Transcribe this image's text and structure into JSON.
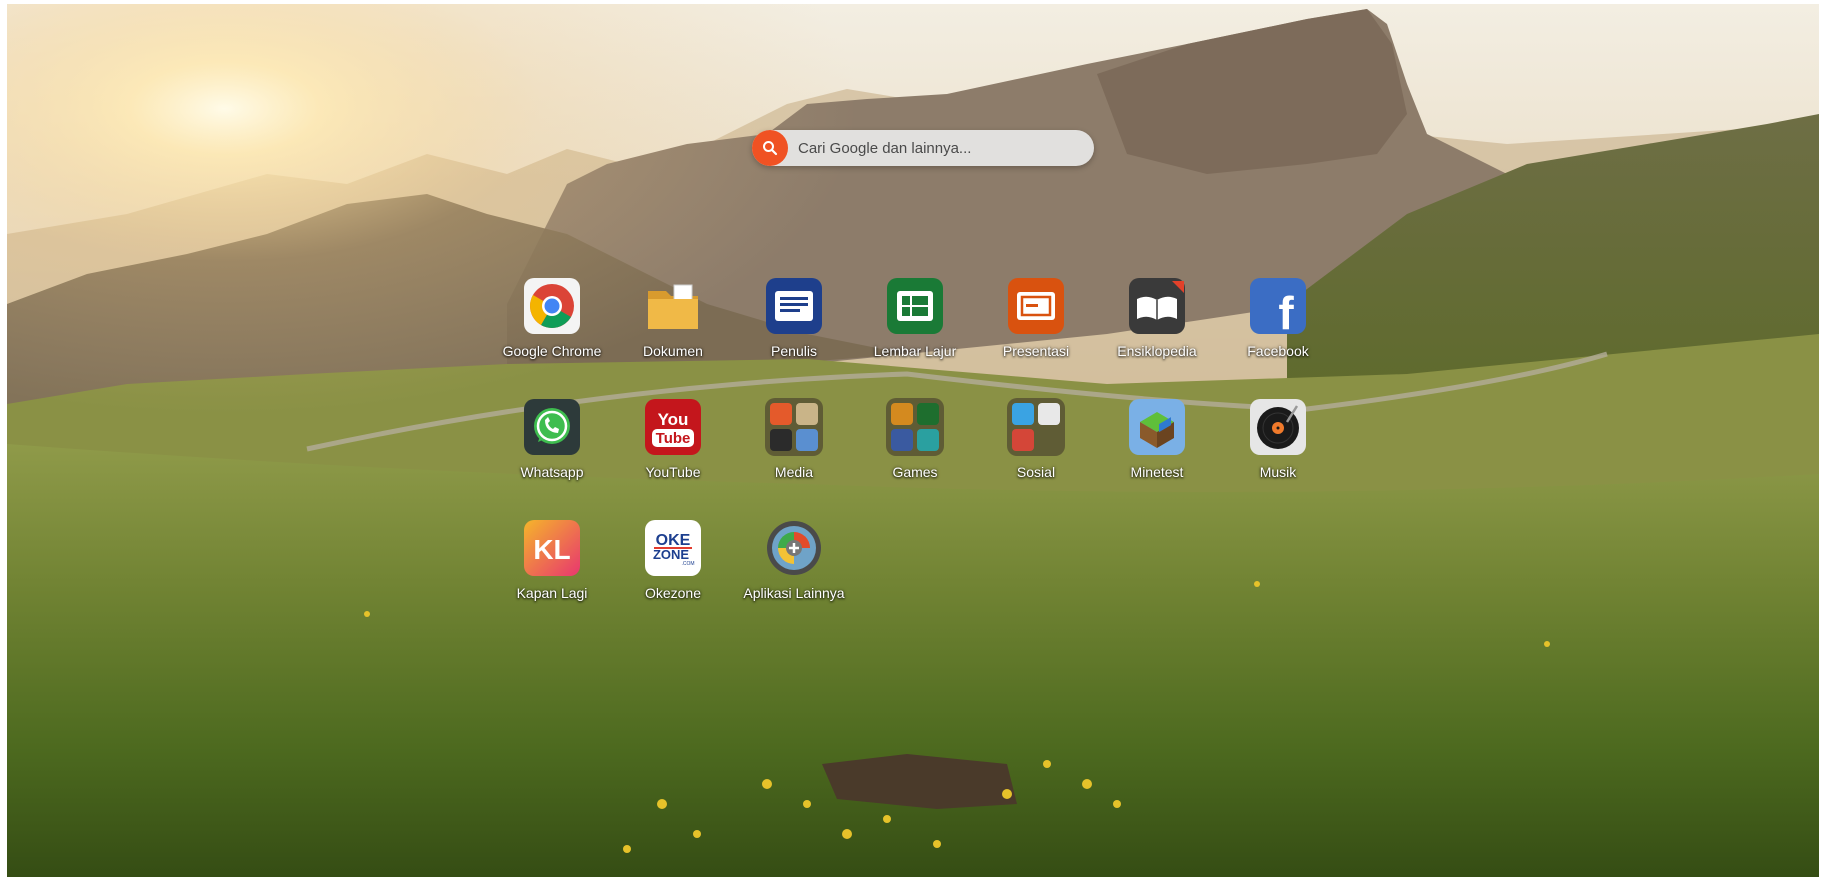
{
  "search": {
    "placeholder": "Cari Google dan lainnya...",
    "icon": "search-icon"
  },
  "apps": [
    {
      "key": "google-chrome",
      "label": "Google Chrome",
      "icon": "chrome-icon"
    },
    {
      "key": "dokumen",
      "label": "Dokumen",
      "icon": "folder-icon"
    },
    {
      "key": "penulis",
      "label": "Penulis",
      "icon": "document-writer-icon"
    },
    {
      "key": "lembar-lajur",
      "label": "Lembar Lajur",
      "icon": "spreadsheet-icon"
    },
    {
      "key": "presentasi",
      "label": "Presentasi",
      "icon": "presentation-icon"
    },
    {
      "key": "ensiklopedia",
      "label": "Ensiklopedia",
      "icon": "book-icon"
    },
    {
      "key": "facebook",
      "label": "Facebook",
      "icon": "facebook-icon"
    },
    {
      "key": "whatsapp",
      "label": "Whatsapp",
      "icon": "whatsapp-icon"
    },
    {
      "key": "youtube",
      "label": "YouTube",
      "icon": "youtube-icon"
    },
    {
      "key": "media",
      "label": "Media",
      "icon": "media-folder-icon"
    },
    {
      "key": "games",
      "label": "Games",
      "icon": "games-folder-icon"
    },
    {
      "key": "sosial",
      "label": "Sosial",
      "icon": "social-folder-icon"
    },
    {
      "key": "minetest",
      "label": "Minetest",
      "icon": "minetest-icon"
    },
    {
      "key": "musik",
      "label": "Musik",
      "icon": "music-player-icon"
    },
    {
      "key": "kapan-lagi",
      "label": "Kapan Lagi",
      "icon": "kapanlagi-icon"
    },
    {
      "key": "okezone",
      "label": "Okezone",
      "icon": "okezone-icon"
    },
    {
      "key": "aplikasi-lainnya",
      "label": "Aplikasi Lainnya",
      "icon": "more-apps-icon"
    }
  ],
  "logos": {
    "youtube": "You Tube",
    "okezone": "OKE ZONE .COM",
    "kapanlagi": "KL",
    "facebook": "f"
  },
  "colors": {
    "search_accent": "#f05223"
  }
}
